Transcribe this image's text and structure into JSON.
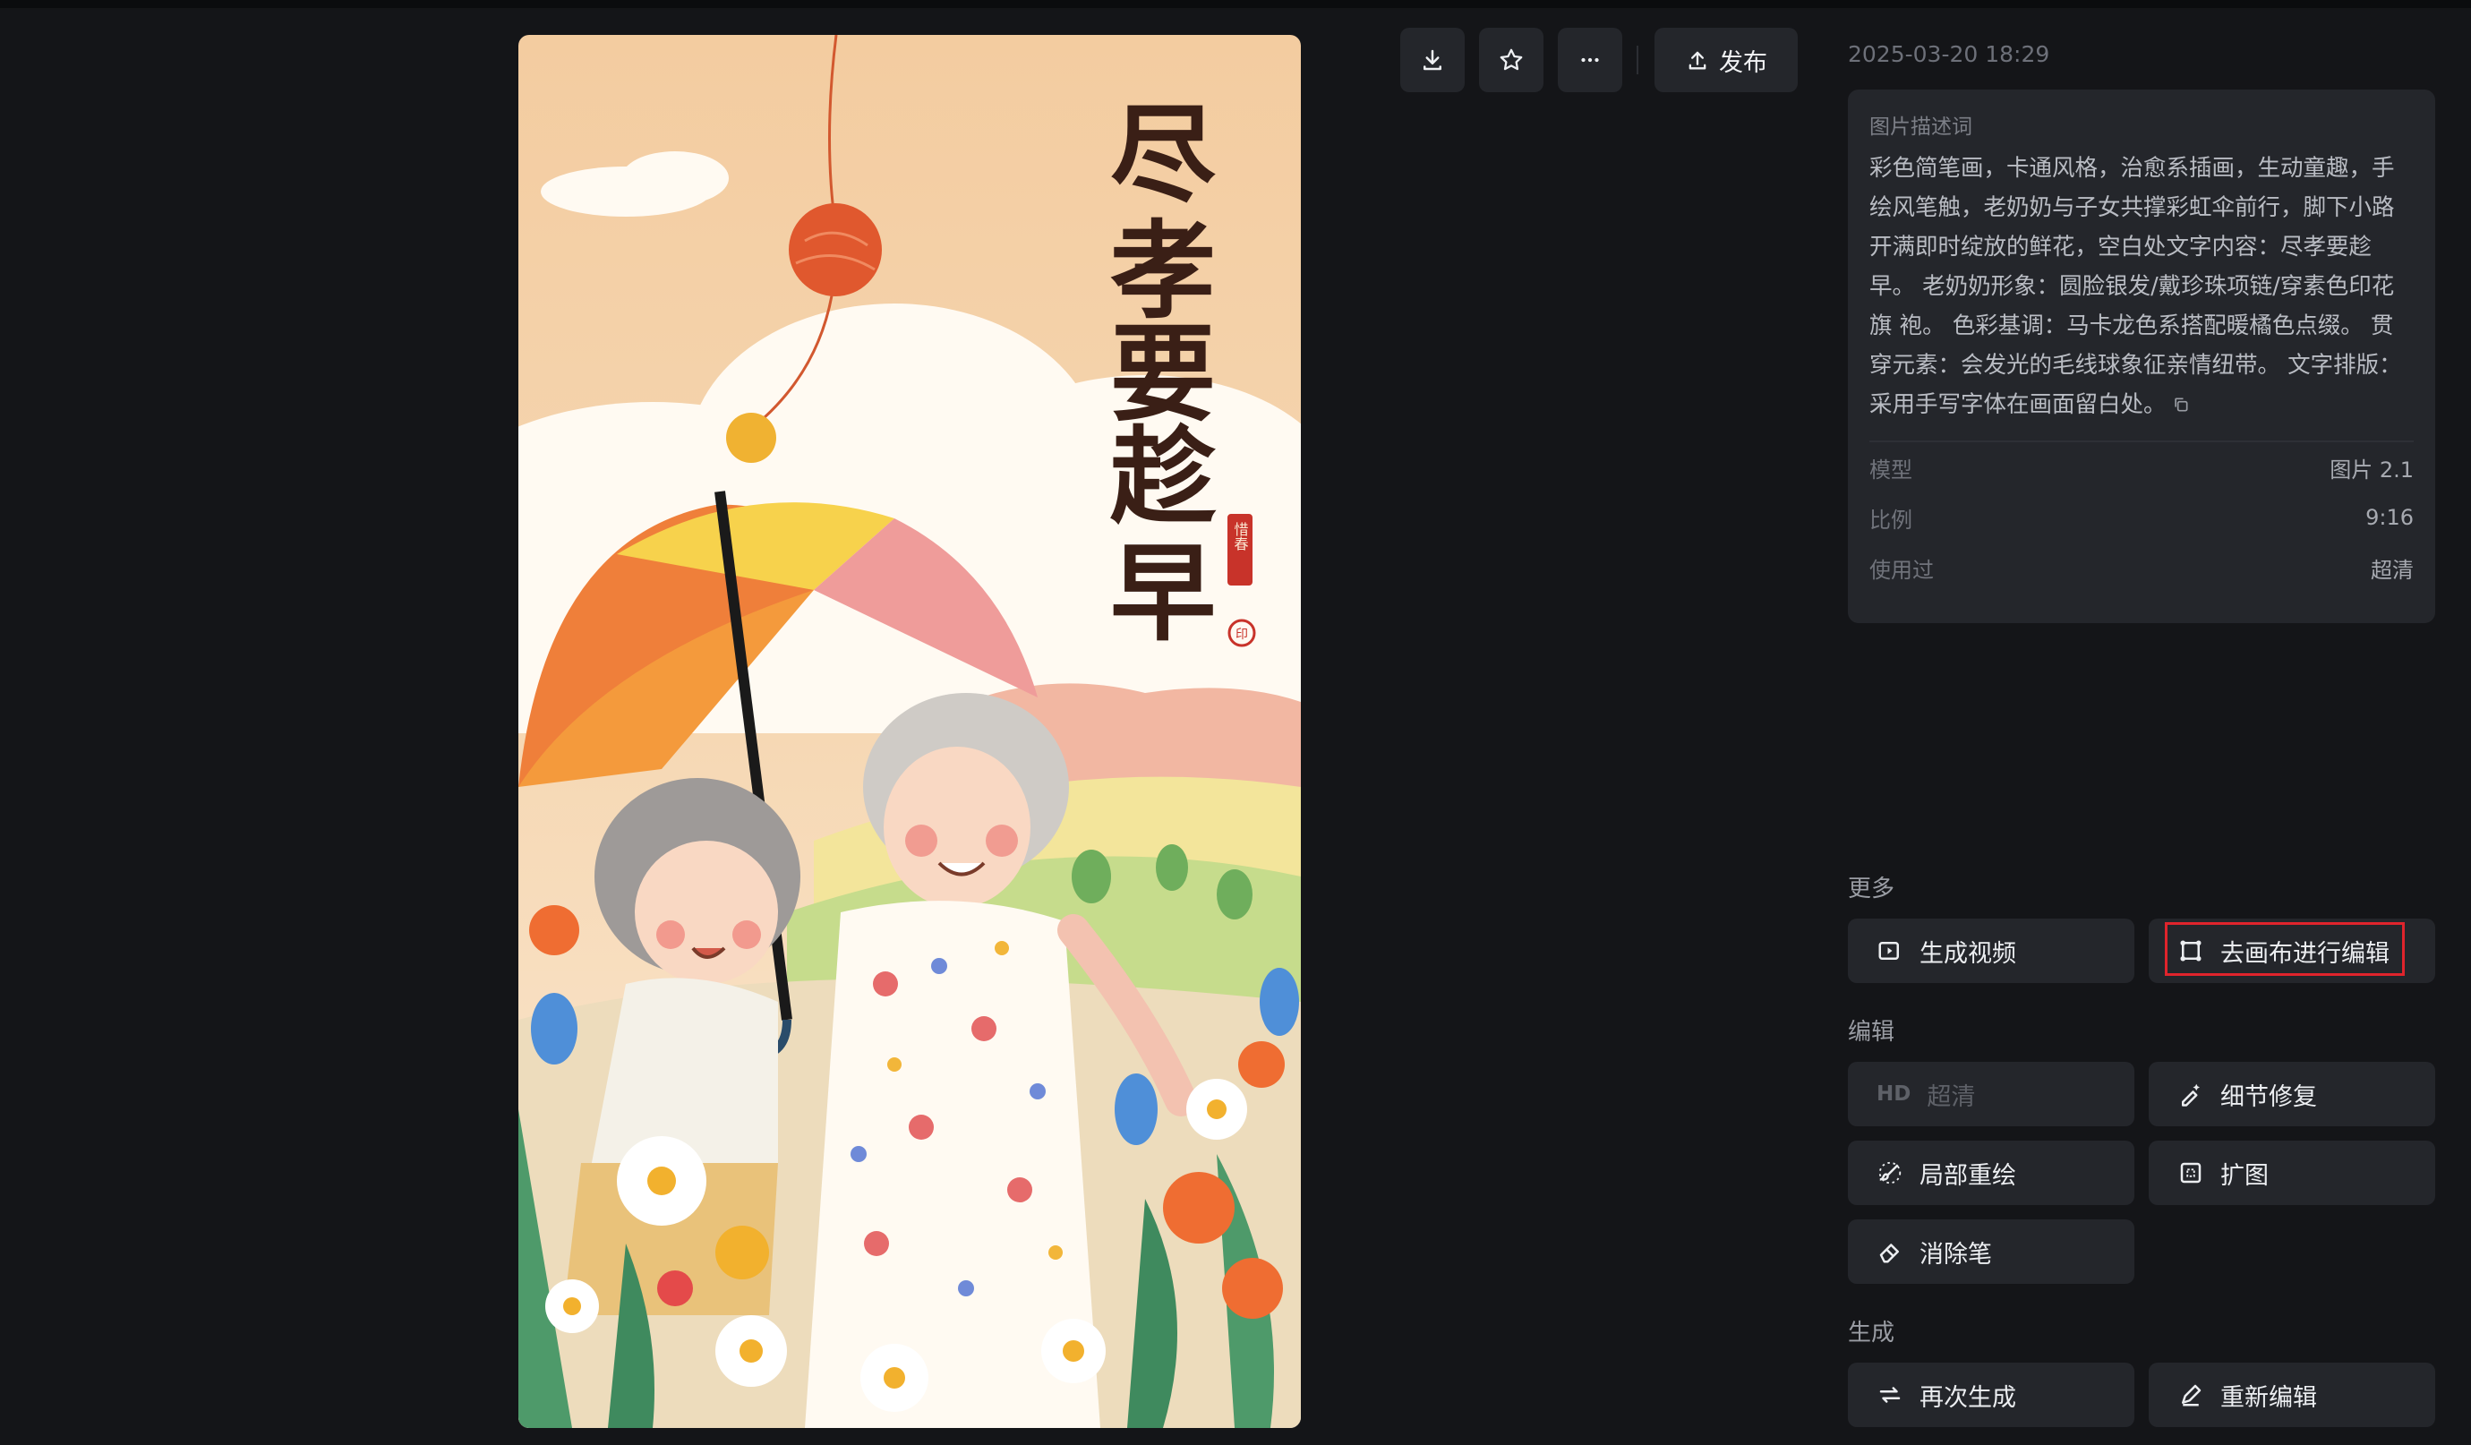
{
  "toolbar": {
    "download_icon": "download-icon",
    "favorite_icon": "star-icon",
    "more_icon": "more-icon",
    "publish_label": "发布"
  },
  "artwork": {
    "calligraphy": [
      "尽",
      "孝",
      "要",
      "趁",
      "早"
    ],
    "seal_text": "惜春",
    "small_seal": "印"
  },
  "info": {
    "timestamp": "2025-03-20 18:29",
    "desc_title": "图片描述词",
    "description": "彩色简笔画，卡通风格，治愈系插画，生动童趣，手绘风笔触，老奶奶与子女共撑彩虹伞前行，脚下小路开满即时绽放的鲜花，空白处文字内容：尽孝要趁早。 老奶奶形象：圆脸银发/戴珍珠项链/穿素色印花旗 袍。 色彩基调：马卡龙色系搭配暖橘色点缀。 贯穿元素：会发光的毛线球象征亲情纽带。 文字排版：采用手写字体在画面留白处。",
    "meta": [
      {
        "key": "模型",
        "value": "图片 2.1"
      },
      {
        "key": "比例",
        "value": "9:16"
      },
      {
        "key": "使用过",
        "value": "超清"
      }
    ]
  },
  "sections": {
    "more": "更多",
    "edit": "编辑",
    "generate": "生成"
  },
  "actions": {
    "generate_video": "生成视频",
    "canvas_edit": "去画布进行编辑",
    "hd_tag": "HD",
    "upscale": "超清",
    "detail_fix": "细节修复",
    "inpaint": "局部重绘",
    "outpaint": "扩图",
    "eraser": "消除笔",
    "regenerate": "再次生成",
    "reedit": "重新编辑"
  }
}
